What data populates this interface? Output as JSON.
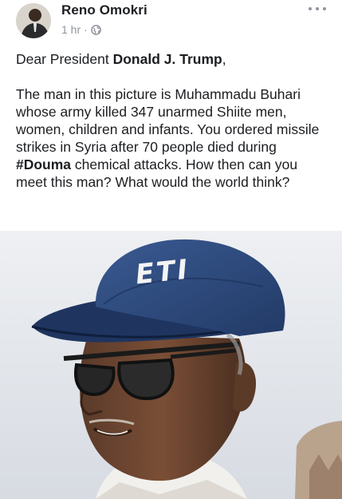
{
  "post": {
    "author": "Reno Omokri",
    "time": "1 hr",
    "separator": "·",
    "privacy_icon": "globe-icon",
    "more_icon": "more-options-icon"
  },
  "body": {
    "greeting_prefix": "Dear President ",
    "greeting_name": "Donald J. Trump",
    "greeting_suffix": ",",
    "paragraph_part1": "The man in this picture is Muhammadu Buhari whose army killed 347 unarmed Shiite men, women, children and infants. You ordered missile strikes in Syria after 70 people died during ",
    "paragraph_hashtag": "#Douma",
    "paragraph_part2": " chemical attacks. How then can you meet this man? What would the world think?"
  },
  "photo": {
    "cap_text": "ETI"
  },
  "colors": {
    "text": "#1c1e21",
    "meta": "#90949c",
    "cap": "#2f4a7c"
  }
}
